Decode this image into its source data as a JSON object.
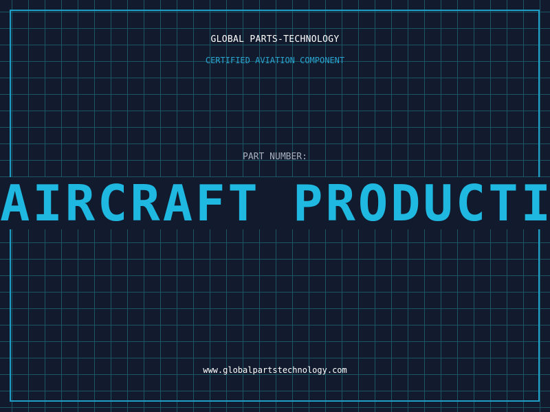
{
  "header": {
    "company": "GLOBAL PARTS-TECHNOLOGY",
    "tagline": "CERTIFIED AVIATION COMPONENT"
  },
  "part": {
    "label": "PART NUMBER:",
    "value": "AIRCRAFT PRODUCTION"
  },
  "footer": {
    "website": "www.globalpartstechnology.com"
  },
  "colors": {
    "background": "#121a2e",
    "grid": "#1c5566",
    "frame": "#1f9fc8",
    "accent": "#1fb8e0"
  }
}
